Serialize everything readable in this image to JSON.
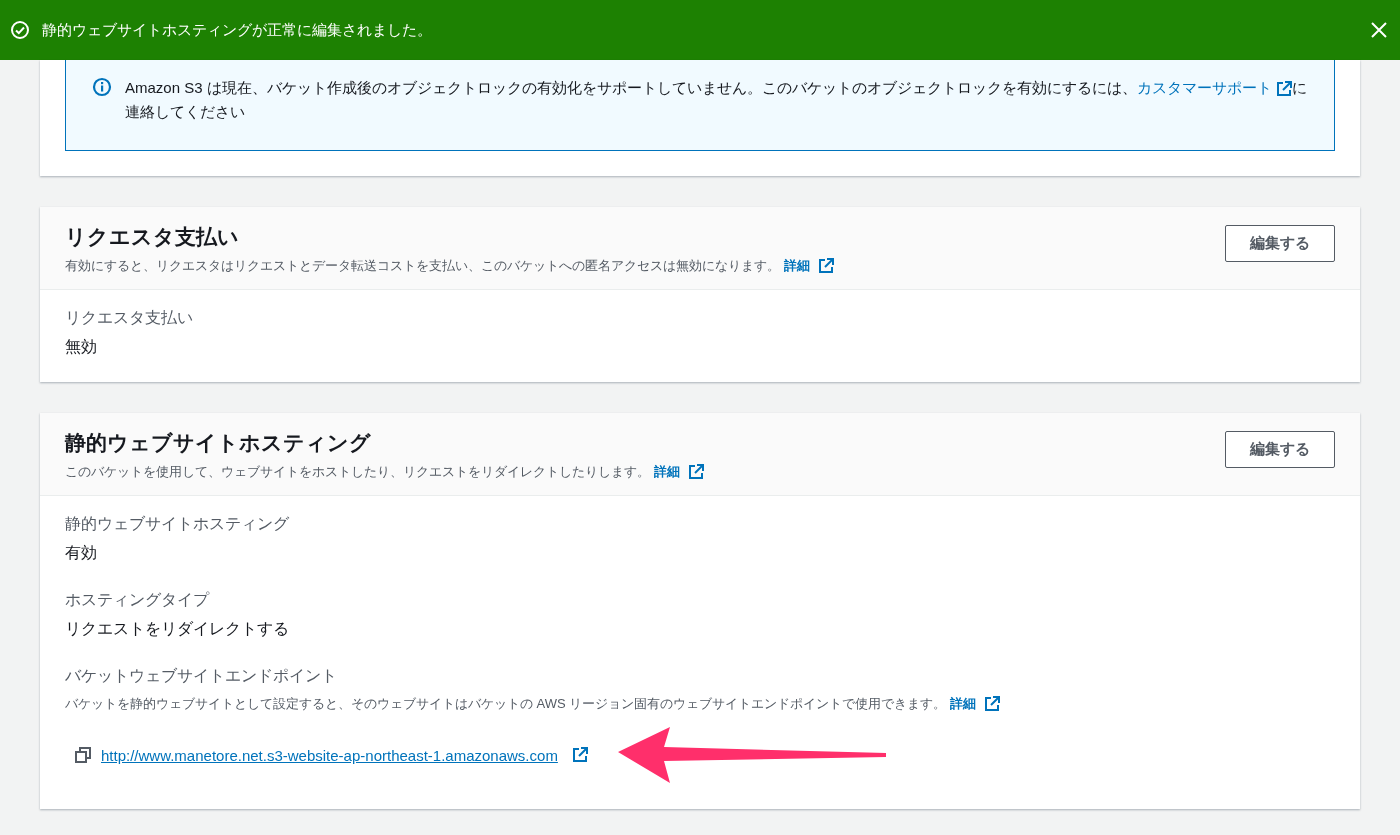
{
  "banner": {
    "message": "静的ウェブサイトホスティングが正常に編集されました。"
  },
  "info_alert": {
    "text": "Amazon S3 は現在、バケット作成後のオブジェクトロックの有効化をサポートしていません。このバケットのオブジェクトロックを有効にするには、",
    "link": "カスタマーサポート",
    "text_after": "に連絡してください"
  },
  "sections": [
    {
      "title": "リクエスタ支払い",
      "description": "有効にすると、リクエスタはリクエストとデータ転送コストを支払い、このバケットへの匿名アクセスは無効になります。",
      "details_link": "詳細",
      "edit_button": "編集する",
      "fields": [
        {
          "kind": "text",
          "label": "リクエスタ支払い",
          "value": "無効"
        }
      ]
    },
    {
      "title": "静的ウェブサイトホスティング",
      "description": "このバケットを使用して、ウェブサイトをホストしたり、リクエストをリダイレクトしたりします。",
      "details_link": "詳細",
      "edit_button": "編集する",
      "fields": [
        {
          "kind": "text",
          "label": "静的ウェブサイトホスティング",
          "value": "有効"
        },
        {
          "kind": "text",
          "label": "ホスティングタイプ",
          "value": "リクエストをリダイレクトする"
        },
        {
          "kind": "endpoint",
          "label": "バケットウェブサイトエンドポイント",
          "description": "バケットを静的ウェブサイトとして設定すると、そのウェブサイトはバケットの AWS リージョン固有のウェブサイトエンドポイントで使用できます。",
          "details_link": "詳細",
          "value": "http://www.manetore.net.s3-website-ap-northeast-1.amazonaws.com"
        }
      ]
    }
  ]
}
